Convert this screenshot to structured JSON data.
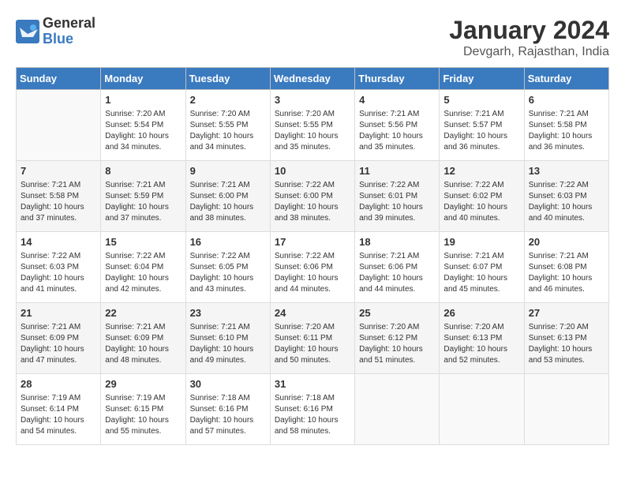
{
  "logo": {
    "general": "General",
    "blue": "Blue"
  },
  "title": "January 2024",
  "location": "Devgarh, Rajasthan, India",
  "days_of_week": [
    "Sunday",
    "Monday",
    "Tuesday",
    "Wednesday",
    "Thursday",
    "Friday",
    "Saturday"
  ],
  "weeks": [
    [
      {
        "day": "",
        "info": ""
      },
      {
        "day": "1",
        "info": "Sunrise: 7:20 AM\nSunset: 5:54 PM\nDaylight: 10 hours\nand 34 minutes."
      },
      {
        "day": "2",
        "info": "Sunrise: 7:20 AM\nSunset: 5:55 PM\nDaylight: 10 hours\nand 34 minutes."
      },
      {
        "day": "3",
        "info": "Sunrise: 7:20 AM\nSunset: 5:55 PM\nDaylight: 10 hours\nand 35 minutes."
      },
      {
        "day": "4",
        "info": "Sunrise: 7:21 AM\nSunset: 5:56 PM\nDaylight: 10 hours\nand 35 minutes."
      },
      {
        "day": "5",
        "info": "Sunrise: 7:21 AM\nSunset: 5:57 PM\nDaylight: 10 hours\nand 36 minutes."
      },
      {
        "day": "6",
        "info": "Sunrise: 7:21 AM\nSunset: 5:58 PM\nDaylight: 10 hours\nand 36 minutes."
      }
    ],
    [
      {
        "day": "7",
        "info": "Sunrise: 7:21 AM\nSunset: 5:58 PM\nDaylight: 10 hours\nand 37 minutes."
      },
      {
        "day": "8",
        "info": "Sunrise: 7:21 AM\nSunset: 5:59 PM\nDaylight: 10 hours\nand 37 minutes."
      },
      {
        "day": "9",
        "info": "Sunrise: 7:21 AM\nSunset: 6:00 PM\nDaylight: 10 hours\nand 38 minutes."
      },
      {
        "day": "10",
        "info": "Sunrise: 7:22 AM\nSunset: 6:00 PM\nDaylight: 10 hours\nand 38 minutes."
      },
      {
        "day": "11",
        "info": "Sunrise: 7:22 AM\nSunset: 6:01 PM\nDaylight: 10 hours\nand 39 minutes."
      },
      {
        "day": "12",
        "info": "Sunrise: 7:22 AM\nSunset: 6:02 PM\nDaylight: 10 hours\nand 40 minutes."
      },
      {
        "day": "13",
        "info": "Sunrise: 7:22 AM\nSunset: 6:03 PM\nDaylight: 10 hours\nand 40 minutes."
      }
    ],
    [
      {
        "day": "14",
        "info": "Sunrise: 7:22 AM\nSunset: 6:03 PM\nDaylight: 10 hours\nand 41 minutes."
      },
      {
        "day": "15",
        "info": "Sunrise: 7:22 AM\nSunset: 6:04 PM\nDaylight: 10 hours\nand 42 minutes."
      },
      {
        "day": "16",
        "info": "Sunrise: 7:22 AM\nSunset: 6:05 PM\nDaylight: 10 hours\nand 43 minutes."
      },
      {
        "day": "17",
        "info": "Sunrise: 7:22 AM\nSunset: 6:06 PM\nDaylight: 10 hours\nand 44 minutes."
      },
      {
        "day": "18",
        "info": "Sunrise: 7:21 AM\nSunset: 6:06 PM\nDaylight: 10 hours\nand 44 minutes."
      },
      {
        "day": "19",
        "info": "Sunrise: 7:21 AM\nSunset: 6:07 PM\nDaylight: 10 hours\nand 45 minutes."
      },
      {
        "day": "20",
        "info": "Sunrise: 7:21 AM\nSunset: 6:08 PM\nDaylight: 10 hours\nand 46 minutes."
      }
    ],
    [
      {
        "day": "21",
        "info": "Sunrise: 7:21 AM\nSunset: 6:09 PM\nDaylight: 10 hours\nand 47 minutes."
      },
      {
        "day": "22",
        "info": "Sunrise: 7:21 AM\nSunset: 6:09 PM\nDaylight: 10 hours\nand 48 minutes."
      },
      {
        "day": "23",
        "info": "Sunrise: 7:21 AM\nSunset: 6:10 PM\nDaylight: 10 hours\nand 49 minutes."
      },
      {
        "day": "24",
        "info": "Sunrise: 7:20 AM\nSunset: 6:11 PM\nDaylight: 10 hours\nand 50 minutes."
      },
      {
        "day": "25",
        "info": "Sunrise: 7:20 AM\nSunset: 6:12 PM\nDaylight: 10 hours\nand 51 minutes."
      },
      {
        "day": "26",
        "info": "Sunrise: 7:20 AM\nSunset: 6:13 PM\nDaylight: 10 hours\nand 52 minutes."
      },
      {
        "day": "27",
        "info": "Sunrise: 7:20 AM\nSunset: 6:13 PM\nDaylight: 10 hours\nand 53 minutes."
      }
    ],
    [
      {
        "day": "28",
        "info": "Sunrise: 7:19 AM\nSunset: 6:14 PM\nDaylight: 10 hours\nand 54 minutes."
      },
      {
        "day": "29",
        "info": "Sunrise: 7:19 AM\nSunset: 6:15 PM\nDaylight: 10 hours\nand 55 minutes."
      },
      {
        "day": "30",
        "info": "Sunrise: 7:18 AM\nSunset: 6:16 PM\nDaylight: 10 hours\nand 57 minutes."
      },
      {
        "day": "31",
        "info": "Sunrise: 7:18 AM\nSunset: 6:16 PM\nDaylight: 10 hours\nand 58 minutes."
      },
      {
        "day": "",
        "info": ""
      },
      {
        "day": "",
        "info": ""
      },
      {
        "day": "",
        "info": ""
      }
    ]
  ]
}
